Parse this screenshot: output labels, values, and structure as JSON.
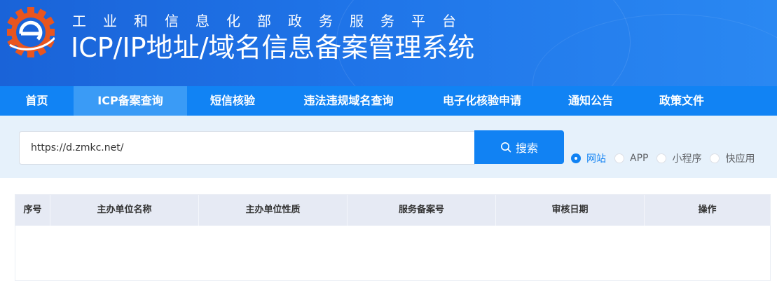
{
  "header": {
    "subtitle": "工业和信息化部政务服务平台",
    "title": "ICP/IP地址/域名信息备案管理系统"
  },
  "nav": {
    "items": [
      {
        "label": "首页",
        "active": false
      },
      {
        "label": "ICP备案查询",
        "active": true
      },
      {
        "label": "短信核验",
        "active": false
      },
      {
        "label": "违法违规域名查询",
        "active": false
      },
      {
        "label": "电子化核验申请",
        "active": false
      },
      {
        "label": "通知公告",
        "active": false
      },
      {
        "label": "政策文件",
        "active": false
      }
    ]
  },
  "search": {
    "value": "https://d.zmkc.net/",
    "button_label": "搜索",
    "button_icon": "search-icon",
    "options": [
      {
        "label": "网站",
        "checked": true
      },
      {
        "label": "APP",
        "checked": false
      },
      {
        "label": "小程序",
        "checked": false
      },
      {
        "label": "快应用",
        "checked": false
      }
    ]
  },
  "table": {
    "columns": [
      "序号",
      "主办单位名称",
      "主办单位性质",
      "服务备案号",
      "审核日期",
      "操作"
    ],
    "rows": []
  },
  "colors": {
    "header_blue": "#1a63d8",
    "nav_blue": "#1183f4",
    "nav_active": "#3a9bf6",
    "button_blue": "#1182f3",
    "band_bg": "#e6f1fb",
    "table_head_bg": "#e6eaf4",
    "logo_orange": "#e8551f"
  }
}
